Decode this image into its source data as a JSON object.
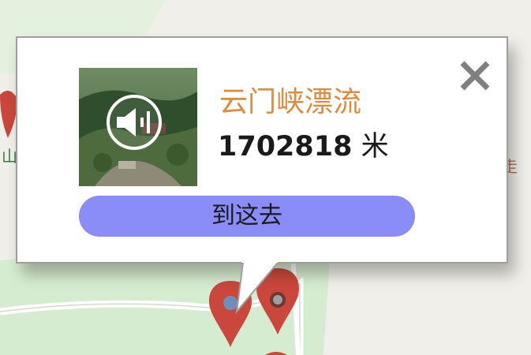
{
  "popup": {
    "title": "云门峡漂流",
    "distance_value": "1702818",
    "distance_unit": "米",
    "go_button_label": "到这去",
    "close_icon": "close-icon",
    "audio_icon": "speaker-icon"
  },
  "colors": {
    "title": "#e08a3c",
    "go_button": "#8a8cf8",
    "map_bg": "#f1efe9",
    "park_green": "#d6ecd0",
    "marker_red": "#c9483b"
  }
}
